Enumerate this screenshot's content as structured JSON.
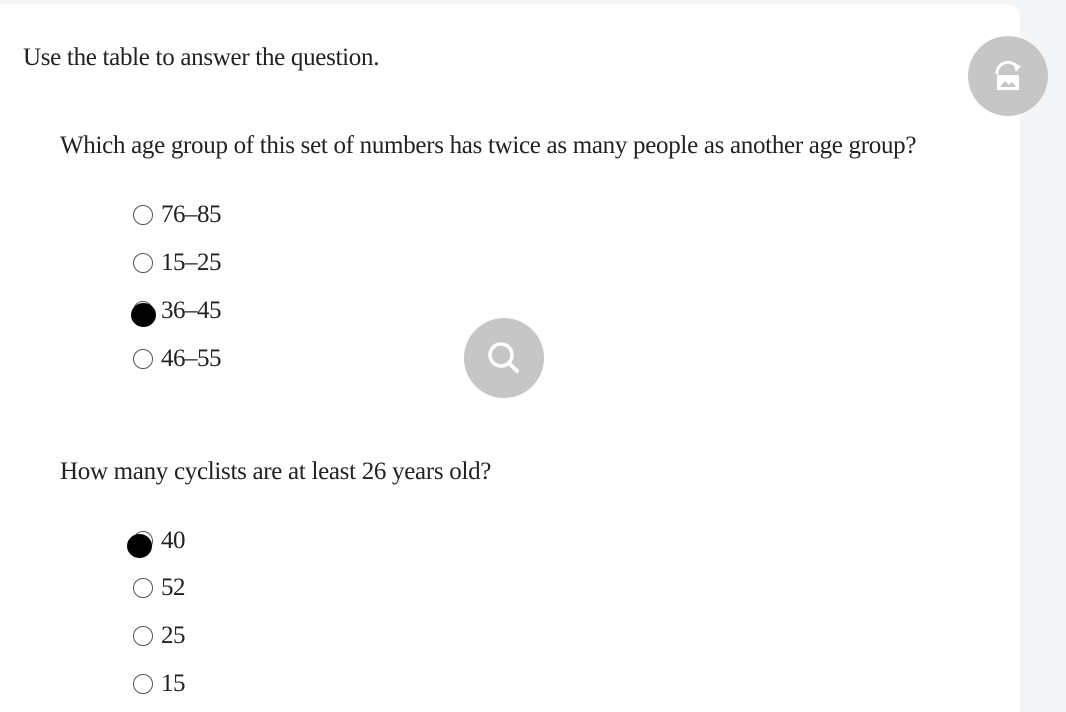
{
  "instruction": "Use the table to answer the question.",
  "questions": [
    {
      "text": "Which age group of this set of numbers has twice as many people as another age group?",
      "options": [
        "76–85",
        "15–25",
        "36–45",
        "46–55"
      ],
      "selected": "36–45"
    },
    {
      "text": "How many cyclists are at least 26 years old?",
      "options": [
        "40",
        "52",
        "25",
        "15"
      ],
      "selected": "40"
    }
  ],
  "overlay": {
    "rotate_icon": "rotate-image-icon",
    "search_icon": "search-icon",
    "button_color": "#c6c6c6"
  }
}
